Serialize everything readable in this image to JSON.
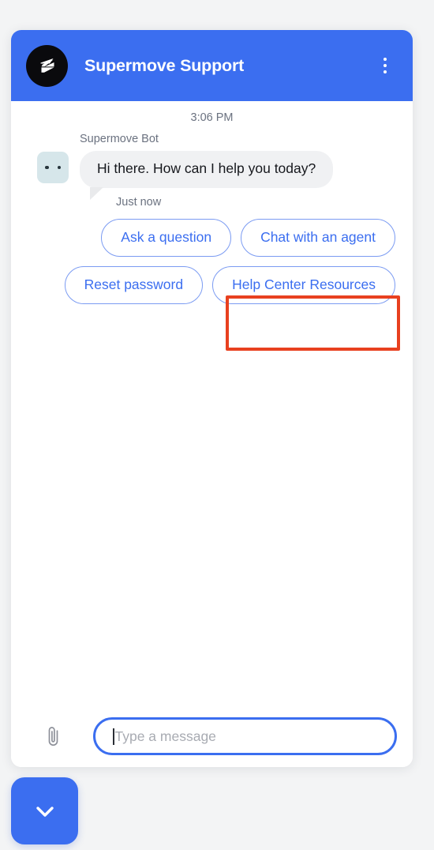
{
  "header": {
    "title": "Supermove Support",
    "logo_icon": "supermove-bolt-logo",
    "menu_icon": "kebab-menu-icon"
  },
  "conversation": {
    "timestamp": "3:06 PM",
    "message": {
      "sender": "Supermove Bot",
      "text": "Hi there. How can I help you today?",
      "meta": "Just now",
      "avatar_icon": "bot-avatar-icon"
    }
  },
  "quick_replies": [
    {
      "label": "Ask a question"
    },
    {
      "label": "Chat with an agent"
    },
    {
      "label": "Reset password"
    },
    {
      "label": "Help Center Resources"
    }
  ],
  "composer": {
    "attach_icon": "paperclip-icon",
    "placeholder": "Type a message",
    "value": ""
  },
  "launcher": {
    "icon": "chevron-down-icon"
  },
  "annotation": {
    "target": "Chat with an agent",
    "color": "#e8401f"
  },
  "colors": {
    "brand_blue": "#3b6ef0",
    "page_background": "#f3f4f5",
    "bubble_background": "#f0f1f3",
    "avatar_background": "#d6e6ea",
    "highlight_red": "#e8401f"
  }
}
